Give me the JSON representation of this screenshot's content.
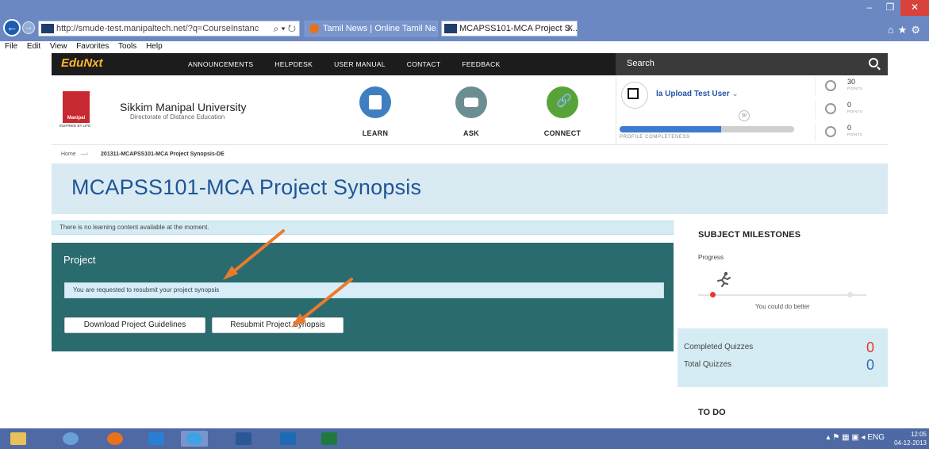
{
  "browser": {
    "url": "http://smude-test.manipaltech.net/?q=CourseInstanc",
    "tabs": [
      {
        "label": "Tamil News | Online Tamil Ne..."
      },
      {
        "label": "MCAPSS101-MCA Project S..."
      }
    ],
    "menu": [
      "File",
      "Edit",
      "View",
      "Favorites",
      "Tools",
      "Help"
    ]
  },
  "site": {
    "brand": "EduNxt",
    "nav": [
      "ANNOUNCEMENTS",
      "HELPDESK",
      "USER MANUAL",
      "CONTACT",
      "FEEDBACK"
    ],
    "search_label": "Search"
  },
  "header": {
    "university": "Sikkim Manipal University",
    "directorate": "Directorate of Distance Education",
    "logo_word": "Manipal",
    "logo_tagline": "INSPIRED BY LIFE",
    "actions": [
      "LEARN",
      "ASK",
      "CONNECT"
    ]
  },
  "user": {
    "name": "la Upload Test User",
    "completeness_value": "50",
    "completeness_pct": 0.58,
    "completeness_label": "PROFILE COMPLETENESS",
    "points": [
      {
        "value": "30",
        "label": "POINTS"
      },
      {
        "value": "0",
        "label": "POINTS"
      },
      {
        "value": "0",
        "label": "POINTS"
      }
    ]
  },
  "breadcrumb": {
    "home": "Home",
    "current": "201311-MCAPSS101-MCA Project Synopsis-DE"
  },
  "page": {
    "title": "MCAPSS101-MCA Project Synopsis",
    "notice": "There is no learning content available at the moment."
  },
  "project": {
    "title": "Project",
    "message": "You are requested to resubmit your project synopsis",
    "download_btn": "Download Project Guidelines",
    "resubmit_btn": "Resubmit Project Synopsis"
  },
  "sidebar": {
    "milestones_title": "SUBJECT MILESTONES",
    "progress_label": "Progress",
    "progress_status": "You could do better",
    "completed_quizzes_label": "Completed Quizzes",
    "completed_quizzes": "0",
    "total_quizzes_label": "Total Quizzes",
    "total_quizzes": "0",
    "todo_title": "TO DO"
  },
  "taskbar": {
    "language": "ENG",
    "time": "12:05",
    "date": "04-12-2013"
  },
  "colors": {
    "panel": "#2a6b6f",
    "title_blue": "#1f5597",
    "banner": "#daeaf3",
    "accent_red": "#e33333",
    "annotation_arrow": "#ec7a2c"
  }
}
